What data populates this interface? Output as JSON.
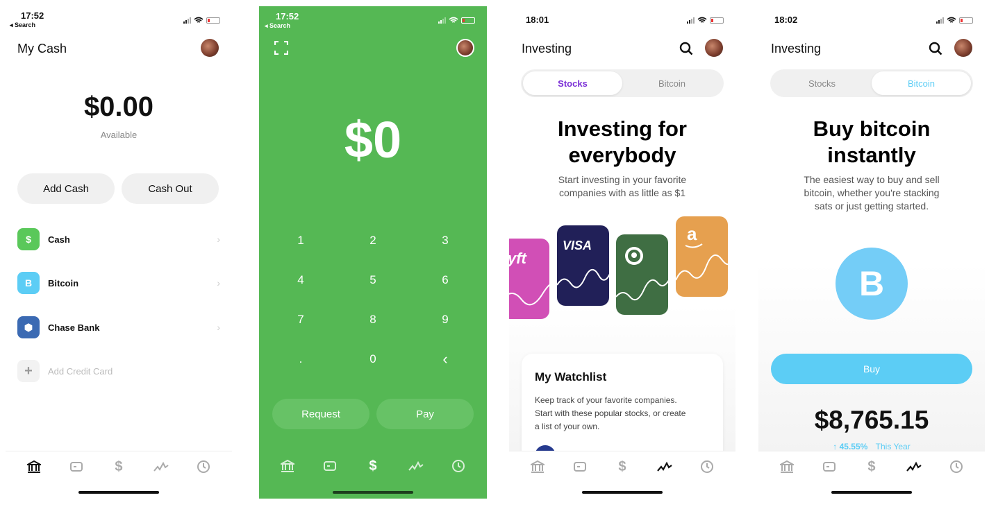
{
  "screens": {
    "my_cash": {
      "time": "17:52",
      "back": "◂ Search",
      "title": "My Cash",
      "balance": "$0.00",
      "balance_label": "Available",
      "add_cash": "Add Cash",
      "cash_out": "Cash Out",
      "rows": [
        {
          "icon": "dollar-icon",
          "glyph": "$",
          "label": "Cash",
          "color": "#5ac85a"
        },
        {
          "icon": "bitcoin-icon",
          "glyph": "B",
          "label": "Bitcoin",
          "color": "#5ccdf5"
        },
        {
          "icon": "chase-icon",
          "glyph": "⬢",
          "label": "Chase Bank",
          "color": "#3b6ab3"
        }
      ],
      "add_credit": "Add Credit Card"
    },
    "keypad": {
      "time": "17:52",
      "back": "◂ Search",
      "amount": "$0",
      "keys": [
        "1",
        "2",
        "3",
        "4",
        "5",
        "6",
        "7",
        "8",
        "9",
        ".",
        "0",
        "‹"
      ],
      "request": "Request",
      "pay": "Pay"
    },
    "investing_stocks": {
      "time": "18:01",
      "title": "Investing",
      "tab_stocks": "Stocks",
      "tab_bitcoin": "Bitcoin",
      "hero_line1": "Investing for",
      "hero_line2": "everybody",
      "sub_line1": "Start investing in your favorite",
      "sub_line2": "companies with as little as $1",
      "cards": [
        {
          "name": "lyft",
          "label": "yft",
          "color": "#d14fb6"
        },
        {
          "name": "visa",
          "label": "VISA",
          "color": "#212058"
        },
        {
          "name": "starbucks",
          "label": "",
          "color": "#3f6e43"
        },
        {
          "name": "amazon",
          "label": "a",
          "color": "#e6a04f"
        }
      ],
      "watchlist_title": "My Watchlist",
      "watchlist_text1": "Keep track of your favorite companies.",
      "watchlist_text2": "Start with these popular stocks, or create",
      "watchlist_text3": "a list of your own."
    },
    "investing_bitcoin": {
      "time": "18:02",
      "title": "Investing",
      "tab_stocks": "Stocks",
      "tab_bitcoin": "Bitcoin",
      "hero_line1": "Buy bitcoin",
      "hero_line2": "instantly",
      "sub_line1": "The easiest way to buy and sell",
      "sub_line2": "bitcoin, whether you're stacking",
      "sub_line3": "sats or just getting started.",
      "btc_glyph": "B",
      "buy": "Buy",
      "price": "$8,765.15",
      "change": "↑ 45.55%",
      "period": "This Year"
    }
  },
  "colors": {
    "green": "#55b854",
    "bitcoin_blue": "#5ccdf5",
    "stocks_purple": "#7a2ed6"
  }
}
